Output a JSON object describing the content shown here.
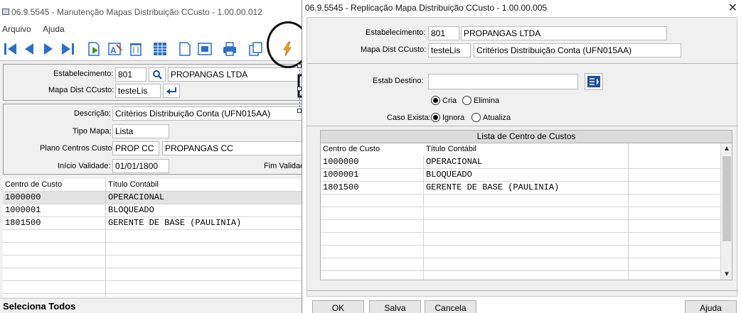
{
  "back_window": {
    "title": "06.9.5545 - Manutenção Mapas Distribuição CCusto - 1.00.00.012",
    "menu": [
      "Arquivo",
      "Ajuda"
    ],
    "toolbar_icons": [
      "first-record-icon",
      "previous-record-icon",
      "next-record-icon",
      "last-record-icon",
      "goto-icon",
      "edit-icon",
      "delete-icon",
      "grid-icon",
      "new-document-icon",
      "preview-icon",
      "print-icon",
      "copy-icon",
      "replicate-lightning-icon"
    ],
    "estabelecimento_label": "Estabelecimento:",
    "estabelecimento_code": "801",
    "estabelecimento_name": "PROPANGAS LTDA",
    "mapa_label": "Mapa Dist CCusto:",
    "mapa_value": "testeLis",
    "descricao_label": "Descrição:",
    "descricao_value": "Critérios Distribuição Conta (UFN015AA)",
    "tipo_mapa_label": "Tipo Mapa:",
    "tipo_mapa_value": "Lista",
    "plano_label": "Plano Centros Custo:",
    "plano_code": "PROP CC",
    "plano_name": "PROPANGAS CC",
    "inicio_label": "Início Validade:",
    "inicio_value": "01/01/1800",
    "fim_label": "Fim Validad",
    "grid_headers": [
      "Centro de Custo",
      "Título Contábil"
    ],
    "grid_rows": [
      [
        "1000000",
        "OPERACIONAL"
      ],
      [
        "1000001",
        "BLOQUEADO"
      ],
      [
        "1801500",
        "GERENTE DE BASE (PAULINIA)"
      ]
    ],
    "status": "Seleciona Todos"
  },
  "dialog": {
    "title": "06.9.5545 - Replicação Mapa Distribuição CCusto - 1.00.00.005",
    "close": "✕",
    "estabelecimento_label": "Estabelecimento:",
    "estabelecimento_code": "801",
    "estabelecimento_name": "PROPANGAS LTDA",
    "mapa_label": "Mapa Dist CCusto:",
    "mapa_value": "testeLis",
    "mapa_desc": "Critérios Distribuição Conta (UFN015AA)",
    "estab_destino_label": "Estab Destino:",
    "estab_destino_value": "",
    "action_cria": "Cria",
    "action_elimina": "Elimina",
    "caso_existe_label": "Caso Exista:",
    "caso_ignora": "Ignora",
    "caso_atualiza": "Atualiza",
    "grid_title": "Lista de Centro de Custos",
    "grid_headers": [
      "Centro de Custo",
      "Título Contábil"
    ],
    "grid_rows": [
      [
        "1000000",
        "OPERACIONAL"
      ],
      [
        "1000001",
        "BLOQUEADO"
      ],
      [
        "1801500",
        "GERENTE DE BASE (PAULINIA)"
      ]
    ],
    "buttons": {
      "ok": "OK",
      "salva": "Salva",
      "cancela": "Cancela",
      "ajuda": "Ajuda"
    }
  },
  "colors": {
    "toolbar_icon_blue": "#2a6fc9",
    "lightning": "#f0a020",
    "selected_row": "#e3e3e3"
  }
}
